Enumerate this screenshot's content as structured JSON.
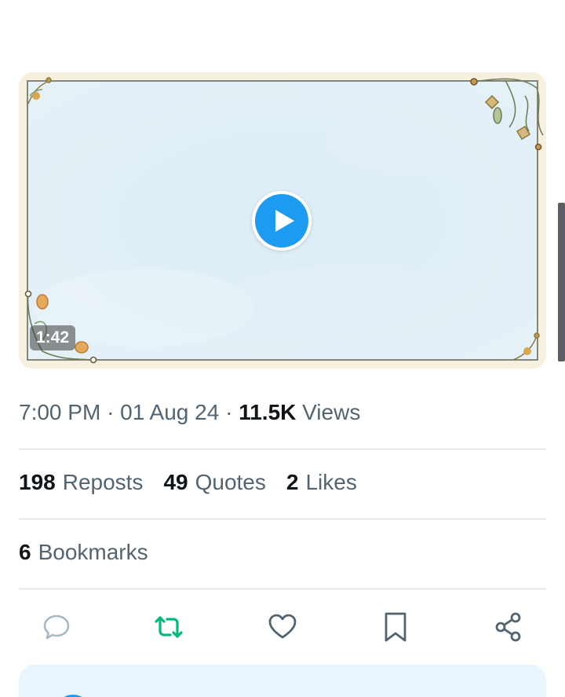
{
  "video": {
    "duration": "1:42",
    "play_icon": "play-icon"
  },
  "meta": {
    "time": "7:00 PM",
    "separator": "·",
    "date": "01 Aug 24",
    "views_count": "11.5K",
    "views_label": "Views"
  },
  "stats": {
    "reposts_count": "198",
    "reposts_label": "Reposts",
    "quotes_count": "49",
    "quotes_label": "Quotes",
    "likes_count": "2",
    "likes_label": "Likes",
    "bookmarks_count": "6",
    "bookmarks_label": "Bookmarks"
  },
  "actions": [
    {
      "icon": "reply-icon",
      "color": "#aab8c2"
    },
    {
      "icon": "repost-icon",
      "color": "#00ba7c"
    },
    {
      "icon": "like-icon",
      "color": "#536471"
    },
    {
      "icon": "bookmark-icon",
      "color": "#536471"
    },
    {
      "icon": "share-icon",
      "color": "#536471"
    }
  ],
  "colors": {
    "accent": "#1d9bf0",
    "repost_active": "#00ba7c",
    "text_primary": "#0f1419",
    "text_secondary": "#536471"
  }
}
